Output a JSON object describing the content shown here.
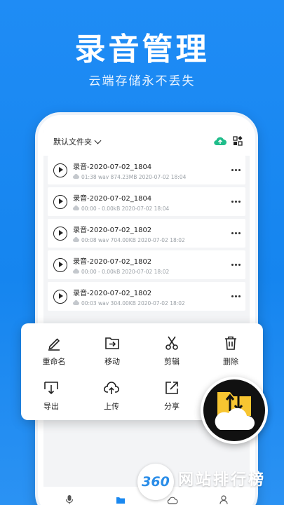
{
  "promo": {
    "headline": "录音管理",
    "subline": "云端存储永不丢失"
  },
  "toolbar": {
    "folder_label": "默认文件夹",
    "icons": [
      "cloud-upload-icon",
      "grid-menu-icon"
    ]
  },
  "recordings": [
    {
      "name": "录音-2020-07-02_1804",
      "meta": "01:38  wav  874.23MB  2020-07-02 18:04"
    },
    {
      "name": "录音-2020-07-02_1804",
      "meta": "00:00  -  0.00kB  2020-07-02 18:04"
    },
    {
      "name": "录音-2020-07-02_1802",
      "meta": "00:08  wav  704.00KB  2020-07-02 18:02"
    },
    {
      "name": "录音-2020-07-02_1802",
      "meta": "00:00  -  0.00kB  2020-07-02 18:02"
    },
    {
      "name": "录音-2020-07-02_1802",
      "meta": "00:03  wav  304.00KB  2020-07-02 18:02"
    }
  ],
  "actions": {
    "rename": "重命名",
    "move": "移动",
    "cut": "剪辑",
    "delete": "删除",
    "export": "导出",
    "upload": "上传",
    "share": "分享"
  },
  "tabs": {
    "record": "录音",
    "files": "文件",
    "cloud": "云端",
    "mine": "我的"
  },
  "colors": {
    "accent": "#1a88f0",
    "background": "#1f8cf5",
    "badge_yellow": "#f7c531"
  },
  "watermark": {
    "number": "360",
    "title": "网站排行榜",
    "domain": "WANGZHAN360.CN"
  }
}
